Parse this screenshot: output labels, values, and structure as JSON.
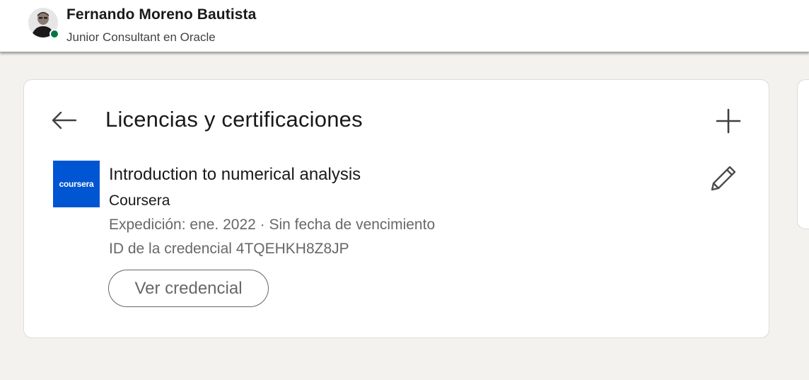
{
  "header": {
    "user_name": "Fernando Moreno Bautista",
    "headline": "Junior Consultant en Oracle",
    "avatar_icon": "profile-photo",
    "presence_color": "#057642"
  },
  "section": {
    "title": "Licencias y certificaciones",
    "back_icon": "arrow-left-icon",
    "add_icon": "plus-icon"
  },
  "certification": {
    "logo_text": "coursera",
    "logo_color": "#0056d2",
    "name": "Introduction to numerical analysis",
    "issuer": "Coursera",
    "dates": "Expedición: ene. 2022 · Sin fecha de vencimiento",
    "credential_id": "ID de la credencial 4TQEHKH8Z8JP",
    "view_button_label": "Ver credencial",
    "edit_icon": "pencil-icon"
  }
}
